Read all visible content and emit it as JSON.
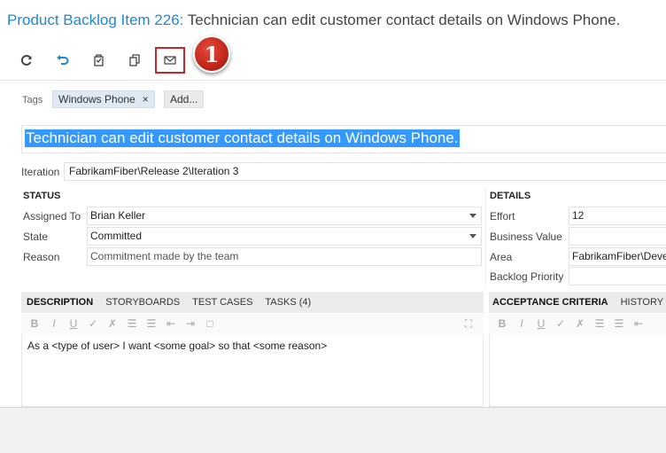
{
  "header": {
    "title_prefix": "Product Backlog Item 226:",
    "title_rest": " Technician can edit customer contact details on Windows Phone."
  },
  "toolbar": {
    "buttons": [
      "refresh-icon",
      "undo-icon",
      "work-item-history-icon",
      "copy-icon",
      "email-icon"
    ],
    "callout_number": "1",
    "callout_color": "#c0261a"
  },
  "tags": {
    "label": "Tags",
    "items": [
      {
        "label": "Windows Phone",
        "close": "×"
      }
    ],
    "add_label": "Add..."
  },
  "work_item": {
    "title": "Technician can edit customer contact details on Windows Phone.",
    "iteration_label": "Iteration",
    "iteration_value": "FabrikamFiber\\Release 2\\Iteration 3"
  },
  "status": {
    "heading": "STATUS",
    "assigned_to_label": "Assigned To",
    "assigned_to_value": "Brian Keller",
    "state_label": "State",
    "state_value": "Committed",
    "reason_label": "Reason",
    "reason_value": "Commitment made by the team"
  },
  "details": {
    "heading": "DETAILS",
    "effort_label": "Effort",
    "effort_value": "12",
    "business_value_label": "Business Value",
    "business_value_value": "",
    "area_label": "Area",
    "area_value": "FabrikamFiber\\Deve",
    "backlog_priority_label": "Backlog Priority",
    "backlog_priority_value": ""
  },
  "left_tabs": [
    "DESCRIPTION",
    "STORYBOARDS",
    "TEST CASES",
    "TASKS (4)"
  ],
  "right_tabs": [
    "ACCEPTANCE CRITERIA",
    "HISTORY",
    "L"
  ],
  "format_buttons": [
    "B",
    "I",
    "U",
    "✓",
    "✗",
    "☰",
    "☰",
    "⇤",
    "⇥",
    "□"
  ],
  "description": {
    "text": "As a <type of user> I want <some goal> so that <some reason>"
  },
  "colors": {
    "accent": "#1e87d6",
    "selection": "#3399ff",
    "highlight_border": "#c62828"
  }
}
